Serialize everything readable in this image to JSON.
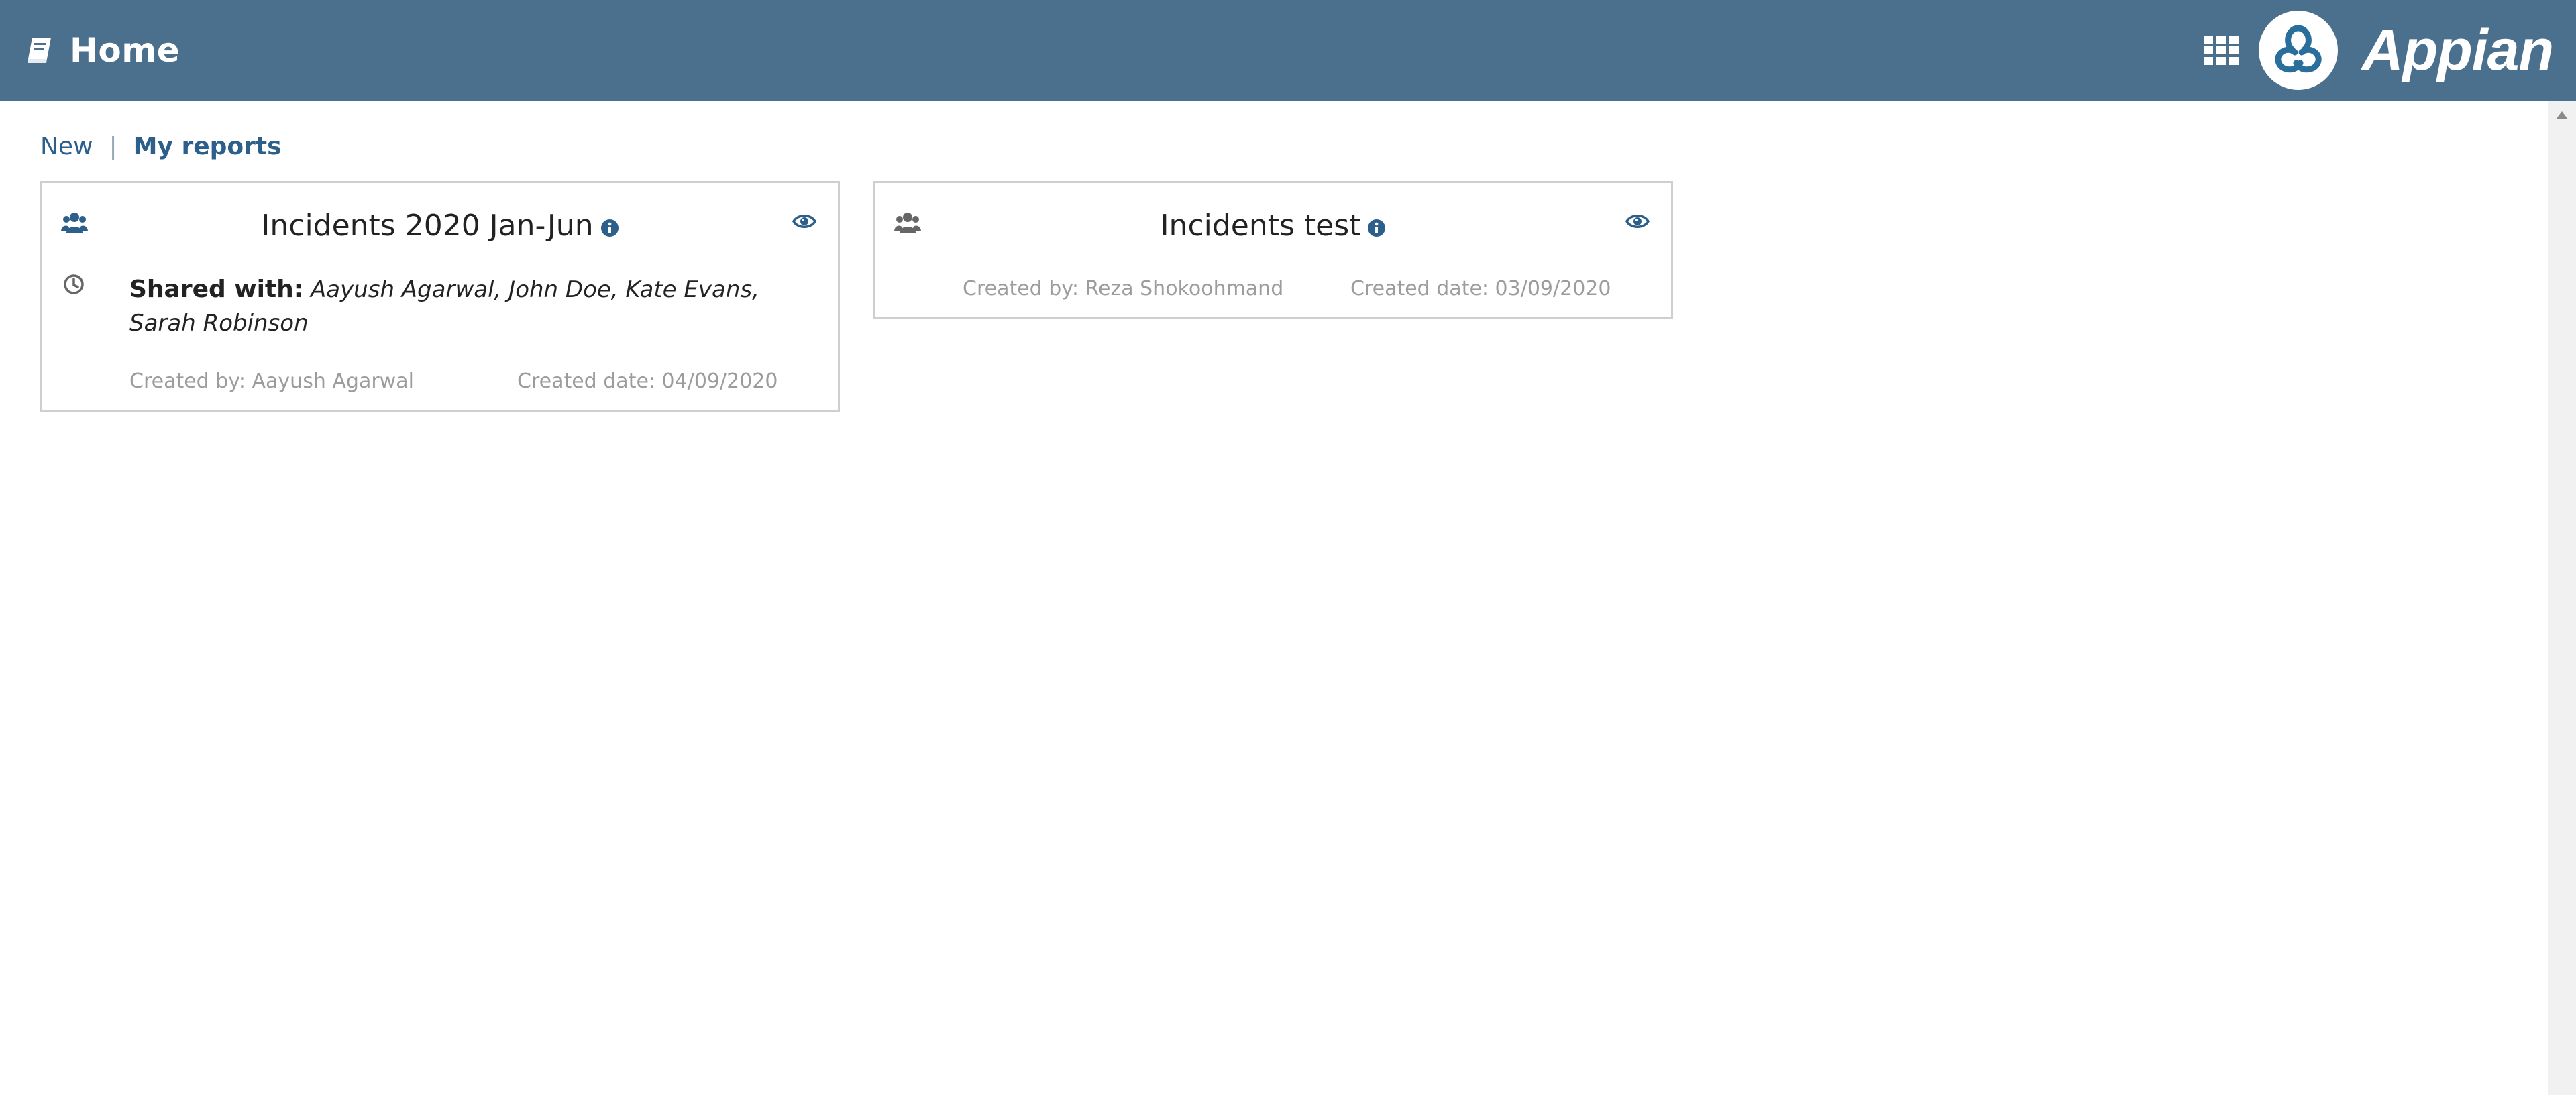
{
  "header": {
    "title": "Home",
    "brand": "Appian",
    "icons": {
      "page": "book-icon",
      "apps": "grid-icon",
      "logo": "appian-logo"
    },
    "color": "#4a708e"
  },
  "tabs": [
    {
      "label": "New",
      "active": false
    },
    {
      "label": "My reports",
      "active": true
    }
  ],
  "tab_separator": "|",
  "reports": [
    {
      "title": "Incidents 2020 Jan-Jun",
      "shared_label": "Shared with:",
      "shared_with": "Aayush Agarwal, John Doe, Kate Evans, Sarah Robinson",
      "created_by": "Created by: Aayush Agarwal",
      "created_date": "Created date: 04/09/2020",
      "icons": [
        "users-icon",
        "clock-icon",
        "info-icon",
        "eye-icon"
      ]
    },
    {
      "title": "Incidents test",
      "created_by": "Created by: Reza Shokoohmand",
      "created_date": "Created date: 03/09/2020",
      "icons": [
        "users-icon",
        "info-icon",
        "eye-icon"
      ]
    }
  ],
  "colors": {
    "accent": "#2c5f8a",
    "meta_text": "#9c9c9c",
    "icon_gray": "#666666"
  }
}
